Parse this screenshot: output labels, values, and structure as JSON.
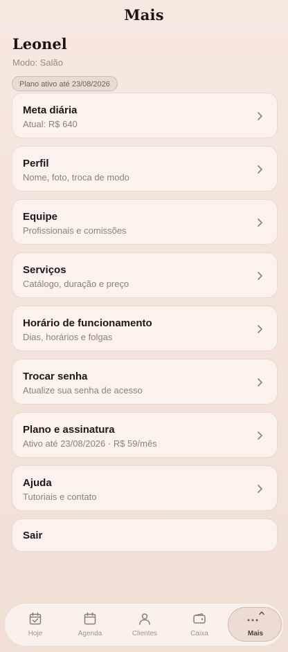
{
  "header": {
    "title": "Mais"
  },
  "user": {
    "name": "Leonel",
    "mode": "Modo: Salão",
    "plan_badge": "Plano ativo até 23/08/2026"
  },
  "menu": [
    {
      "title": "Meta diária",
      "subtitle": "Atual: R$ 640"
    },
    {
      "title": "Perfil",
      "subtitle": "Nome, foto, troca de modo"
    },
    {
      "title": "Equipe",
      "subtitle": "Profissionais e comissões"
    },
    {
      "title": "Serviços",
      "subtitle": "Catálogo, duração e preço"
    },
    {
      "title": "Horário de funcionamento",
      "subtitle": "Dias, horários e folgas"
    },
    {
      "title": "Trocar senha",
      "subtitle": "Atualize sua senha de acesso"
    },
    {
      "title": "Plano e assinatura",
      "subtitle": "Ativo até 23/08/2026 · R$ 59/mês"
    },
    {
      "title": "Ajuda",
      "subtitle": "Tutoriais e contato"
    }
  ],
  "logout": {
    "title": "Sair"
  },
  "tabbar": {
    "tabs": [
      {
        "label": "Hoje",
        "icon": "calendar-check-icon"
      },
      {
        "label": "Agenda",
        "icon": "calendar-icon"
      },
      {
        "label": "Clientes",
        "icon": "user-icon"
      },
      {
        "label": "Caixa",
        "icon": "wallet-icon"
      },
      {
        "label": "Mais",
        "icon": "more-dots-icon",
        "active": true
      }
    ]
  },
  "colors": {
    "background": "#f3e4dc",
    "card": "#fbf2ee",
    "text": "#1f1714",
    "muted": "#8f7f77"
  }
}
